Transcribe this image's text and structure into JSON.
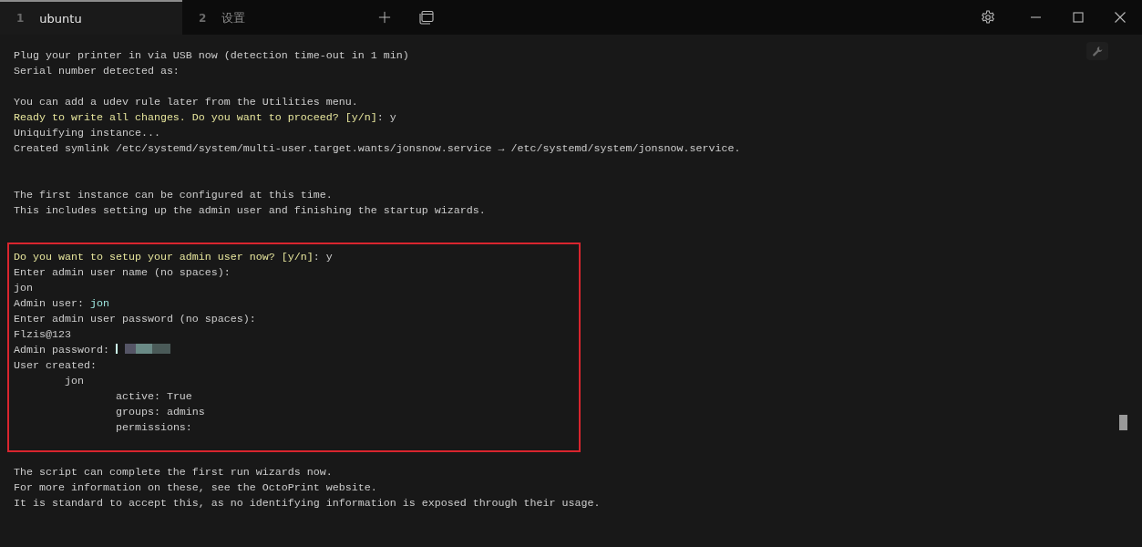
{
  "tabs": [
    {
      "number": "1",
      "label": "ubuntu",
      "selected": true
    },
    {
      "number": "2",
      "label": "设置",
      "selected": false
    }
  ],
  "terminal": {
    "sections": [
      {
        "highlighted": false,
        "lines": [
          {
            "kind": "text",
            "segments": [
              {
                "kind": "plain",
                "text": "Plug your printer in via USB now (detection time-out in 1 min)"
              }
            ]
          },
          {
            "kind": "text",
            "segments": [
              {
                "kind": "plain",
                "text": "Serial number detected as:"
              }
            ]
          },
          {
            "kind": "blank"
          },
          {
            "kind": "text",
            "segments": [
              {
                "kind": "plain",
                "text": "You can add a udev rule later from the Utilities menu."
              }
            ]
          },
          {
            "kind": "text",
            "segments": [
              {
                "kind": "prompt",
                "text": "Ready to write all changes. Do you want to proceed? [y/n]"
              },
              {
                "kind": "plain",
                "text": ": y"
              }
            ]
          },
          {
            "kind": "text",
            "segments": [
              {
                "kind": "plain",
                "text": "Uniquifying instance..."
              }
            ]
          },
          {
            "kind": "text",
            "segments": [
              {
                "kind": "plain",
                "text": "Created symlink /etc/systemd/system/multi-user.target.wants/jonsnow.service → /etc/systemd/system/jonsnow.service."
              }
            ]
          },
          {
            "kind": "blank"
          },
          {
            "kind": "blank"
          },
          {
            "kind": "text",
            "segments": [
              {
                "kind": "plain",
                "text": "The first instance can be configured at this time."
              }
            ]
          },
          {
            "kind": "text",
            "segments": [
              {
                "kind": "plain",
                "text": "This includes setting up the admin user and finishing the startup wizards."
              }
            ]
          },
          {
            "kind": "blank"
          }
        ]
      },
      {
        "highlighted": true,
        "lines": [
          {
            "kind": "text",
            "segments": [
              {
                "kind": "prompt",
                "text": "Do you want to setup your admin user now? [y/n]"
              },
              {
                "kind": "plain",
                "text": ": y"
              }
            ]
          },
          {
            "kind": "text",
            "segments": [
              {
                "kind": "plain",
                "text": "Enter admin user name (no spaces):"
              }
            ]
          },
          {
            "kind": "text",
            "segments": [
              {
                "kind": "plain",
                "text": "jon"
              }
            ]
          },
          {
            "kind": "text",
            "segments": [
              {
                "kind": "plain",
                "text": "Admin user: "
              },
              {
                "kind": "value",
                "text": "jon"
              }
            ]
          },
          {
            "kind": "text",
            "segments": [
              {
                "kind": "plain",
                "text": "Enter admin user password (no spaces):"
              }
            ]
          },
          {
            "kind": "text",
            "segments": [
              {
                "kind": "plain",
                "text": "Flzis@123"
              }
            ]
          },
          {
            "kind": "text",
            "segments": [
              {
                "kind": "plain",
                "text": "Admin password: "
              },
              {
                "kind": "redacted"
              }
            ]
          },
          {
            "kind": "text",
            "segments": [
              {
                "kind": "plain",
                "text": "User created:"
              }
            ]
          },
          {
            "kind": "text",
            "segments": [
              {
                "kind": "plain",
                "text": "\tjon"
              }
            ]
          },
          {
            "kind": "text",
            "segments": [
              {
                "kind": "plain",
                "text": "\t\tactive: True"
              }
            ]
          },
          {
            "kind": "text",
            "segments": [
              {
                "kind": "plain",
                "text": "\t\tgroups: admins"
              }
            ]
          },
          {
            "kind": "text",
            "segments": [
              {
                "kind": "plain",
                "text": "\t\tpermissions:"
              }
            ]
          }
        ]
      },
      {
        "highlighted": false,
        "lines": [
          {
            "kind": "text",
            "segments": [
              {
                "kind": "plain",
                "text": "The script can complete the first run wizards now."
              }
            ]
          },
          {
            "kind": "text",
            "segments": [
              {
                "kind": "plain",
                "text": "For more information on these, see the OctoPrint website."
              }
            ]
          },
          {
            "kind": "text",
            "segments": [
              {
                "kind": "plain",
                "text": "It is standard to accept this, as no identifying information is exposed through their usage."
              }
            ]
          }
        ]
      }
    ]
  }
}
